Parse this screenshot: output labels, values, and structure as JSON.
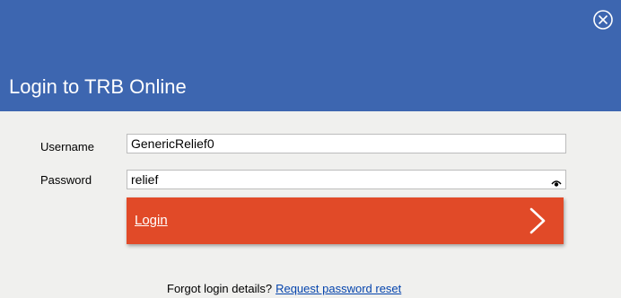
{
  "dialog": {
    "title": "Login to TRB Online",
    "header_color": "#3d66b0",
    "close_icon": "close-circle-icon"
  },
  "form": {
    "username_label": "Username",
    "username_value": "GenericRelief0",
    "password_label": "Password",
    "password_value": "relief",
    "password_toggle_icon": "eye-icon"
  },
  "login_button": {
    "label": "Login",
    "color": "#e14a28",
    "icon": "chevron-right-icon"
  },
  "footer": {
    "prompt": "Forgot login details?",
    "link": "Request password reset"
  }
}
